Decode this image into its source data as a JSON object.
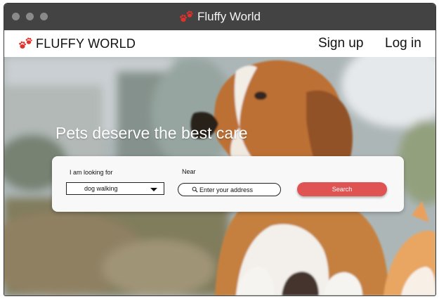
{
  "window": {
    "title": "Fluffy World"
  },
  "navbar": {
    "brand": "FLUFFY WORLD",
    "signup_label": "Sign up",
    "login_label": "Log in"
  },
  "hero": {
    "headline": "Pets deserve the best care"
  },
  "search": {
    "looking_for_label": "I am looking for",
    "service_selected": "dog walking",
    "near_label": "Near",
    "address_placeholder": "Enter your address",
    "button_label": "Search"
  },
  "icons": {
    "traffic_lights": [
      "window-close-icon",
      "window-minimize-icon",
      "window-maximize-icon"
    ],
    "brand": "paw-print-icon",
    "dropdown": "chevron-down-icon",
    "search": "magnifier-icon"
  },
  "colors": {
    "titlebar": "#434343",
    "accent": "#e05353",
    "paw": "#e0312b"
  }
}
